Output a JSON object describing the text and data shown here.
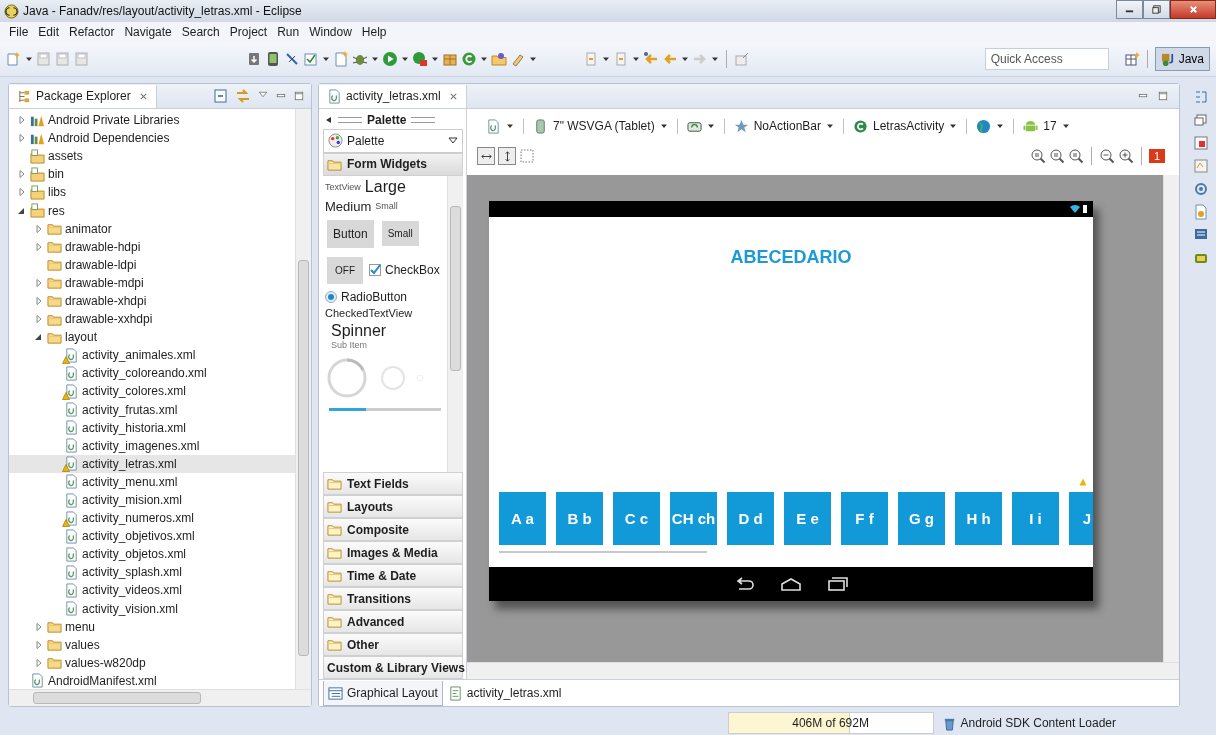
{
  "window": {
    "title": "Java - Fanadv/res/layout/activity_letras.xml - Eclipse"
  },
  "menu": [
    "File",
    "Edit",
    "Refactor",
    "Navigate",
    "Search",
    "Project",
    "Run",
    "Window",
    "Help"
  ],
  "toolbar": {
    "quick_access": {
      "placeholder": "Quick Access"
    },
    "perspective": {
      "label": "Java",
      "selected": true
    }
  },
  "package_explorer": {
    "title": "Package Explorer",
    "tree": [
      {
        "label": "Android Private Libraries",
        "kind": "library",
        "expanded": false
      },
      {
        "label": "Android Dependencies",
        "kind": "library",
        "expanded": false
      },
      {
        "label": "assets",
        "kind": "source"
      },
      {
        "label": "bin",
        "kind": "source",
        "expanded": false
      },
      {
        "label": "libs",
        "kind": "source",
        "expanded": false
      },
      {
        "label": "res",
        "kind": "source",
        "expanded": true,
        "children": [
          {
            "label": "animator",
            "kind": "folder",
            "expanded": false
          },
          {
            "label": "drawable-hdpi",
            "kind": "folder",
            "expanded": false
          },
          {
            "label": "drawable-ldpi",
            "kind": "folder"
          },
          {
            "label": "drawable-mdpi",
            "kind": "folder",
            "expanded": false
          },
          {
            "label": "drawable-xhdpi",
            "kind": "folder",
            "expanded": false
          },
          {
            "label": "drawable-xxhdpi",
            "kind": "folder",
            "expanded": false
          },
          {
            "label": "layout",
            "kind": "folder",
            "expanded": true,
            "children": [
              {
                "label": "activity_animales.xml",
                "kind": "file",
                "warning": true,
                "selected": false
              },
              {
                "label": "activity_coloreando.xml",
                "kind": "file",
                "warning": false,
                "selected": false
              },
              {
                "label": "activity_colores.xml",
                "kind": "file",
                "warning": true,
                "selected": false
              },
              {
                "label": "activity_frutas.xml",
                "kind": "file",
                "warning": false,
                "selected": false
              },
              {
                "label": "activity_historia.xml",
                "kind": "file",
                "warning": false,
                "selected": false
              },
              {
                "label": "activity_imagenes.xml",
                "kind": "file",
                "warning": false,
                "selected": false
              },
              {
                "label": "activity_letras.xml",
                "kind": "file",
                "warning": true,
                "selected": true
              },
              {
                "label": "activity_menu.xml",
                "kind": "file",
                "warning": false,
                "selected": false
              },
              {
                "label": "activity_mision.xml",
                "kind": "file",
                "warning": false,
                "selected": false
              },
              {
                "label": "activity_numeros.xml",
                "kind": "file",
                "warning": true,
                "selected": false
              },
              {
                "label": "activity_objetivos.xml",
                "kind": "file",
                "warning": false,
                "selected": false
              },
              {
                "label": "activity_objetos.xml",
                "kind": "file",
                "warning": false,
                "selected": false
              },
              {
                "label": "activity_splash.xml",
                "kind": "file",
                "warning": false,
                "selected": false
              },
              {
                "label": "activity_videos.xml",
                "kind": "file",
                "warning": false,
                "selected": false
              },
              {
                "label": "activity_vision.xml",
                "kind": "file",
                "warning": false,
                "selected": false
              }
            ]
          },
          {
            "label": "menu",
            "kind": "folder",
            "expanded": false
          },
          {
            "label": "values",
            "kind": "folder",
            "expanded": false
          },
          {
            "label": "values-w820dp",
            "kind": "folder",
            "expanded": false
          }
        ]
      },
      {
        "label": "AndroidManifest.xml",
        "kind": "file"
      }
    ]
  },
  "editor": {
    "tab": {
      "title": "activity_letras.xml"
    },
    "palette": {
      "title": "Palette",
      "picker": "Palette",
      "sections": [
        {
          "label": "Form Widgets",
          "kind": "folder",
          "expanded": true
        },
        {
          "label": "Text Fields",
          "kind": "folder",
          "expanded": false
        },
        {
          "label": "Layouts",
          "kind": "folder",
          "expanded": false
        },
        {
          "label": "Composite",
          "kind": "folder",
          "expanded": false
        },
        {
          "label": "Images & Media",
          "kind": "folder",
          "expanded": false
        },
        {
          "label": "Time & Date",
          "kind": "folder",
          "expanded": false
        },
        {
          "label": "Transitions",
          "kind": "folder",
          "expanded": false
        },
        {
          "label": "Advanced",
          "kind": "folder",
          "expanded": false
        },
        {
          "label": "Other",
          "kind": "folder",
          "expanded": false
        },
        {
          "label": "Custom & Library Views",
          "kind": "plain",
          "expanded": false
        }
      ],
      "form_widgets": {
        "text_views": [
          "TextView",
          "Large",
          "Medium",
          "Small"
        ],
        "buttons": [
          "Button",
          "Small"
        ],
        "toggle": "OFF",
        "checkbox": {
          "label": "CheckBox",
          "checked": true
        },
        "radio": {
          "label": "RadioButton",
          "selected": true
        },
        "checked_text_view": "CheckedTextView",
        "spinner": {
          "label": "Spinner",
          "sub": "Sub Item"
        },
        "progress": {
          "level": 0.33
        }
      }
    },
    "canvas_toolbar": [
      {
        "kind": "file"
      },
      {
        "kind": "tablet",
        "label": "7\" WSVGA (Tablet)"
      },
      {
        "kind": "rotate"
      },
      {
        "kind": "star",
        "label": "NoActionBar"
      },
      {
        "kind": "activity",
        "label": "LetrasActivity"
      },
      {
        "kind": "globe"
      },
      {
        "kind": "android",
        "label": "17"
      }
    ],
    "error_count": "1",
    "device": {
      "title": "ABECEDARIO",
      "letters": [
        "A a",
        "B b",
        "C c",
        "CH ch",
        "D d",
        "E e",
        "F f",
        "G g",
        "H h",
        "I i",
        "J"
      ]
    },
    "bottom_tabs": [
      {
        "label": "Graphical Layout",
        "kind": "layout",
        "selected": true
      },
      {
        "label": "activity_letras.xml",
        "kind": "xml",
        "selected": false
      }
    ]
  },
  "status_bar": {
    "memory": "406M of 692M",
    "level": 0.59,
    "loader": "Android SDK Content Loader"
  }
}
